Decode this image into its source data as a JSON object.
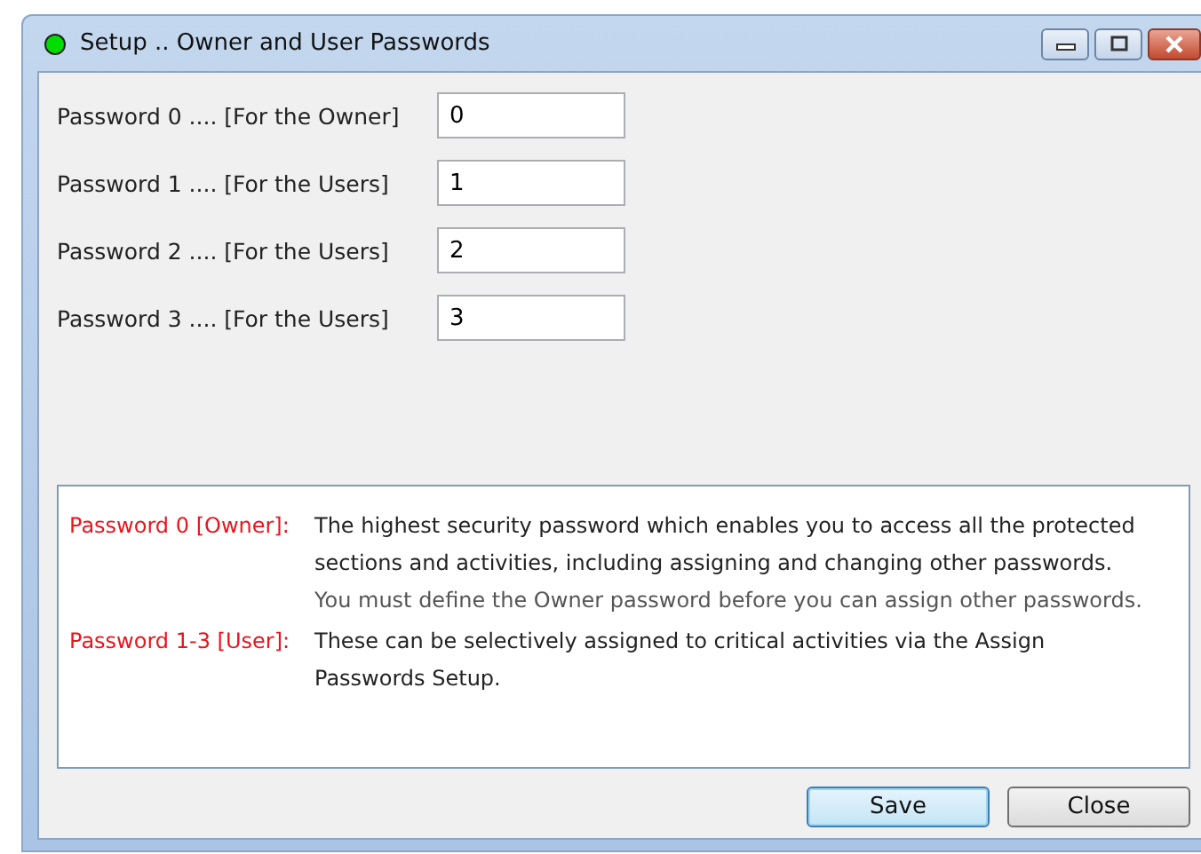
{
  "window": {
    "title": "Setup .. Owner and User Passwords"
  },
  "fields": [
    {
      "label": "Password 0 .... [For the Owner]",
      "value": "0"
    },
    {
      "label": "Password 1 .... [For the Users]",
      "value": "1"
    },
    {
      "label": "Password 2 .... [For the Users]",
      "value": "2"
    },
    {
      "label": "Password 3 .... [For the Users]",
      "value": "3"
    }
  ],
  "notes": [
    {
      "term": "Password 0 [Owner]:",
      "paragraphs": [
        {
          "kind": "main",
          "text": "The highest security password which enables you to access all the protected sections and activities, including assigning and changing other passwords."
        },
        {
          "kind": "hint",
          "text": "You must define the Owner password before you can assign other passwords."
        }
      ]
    },
    {
      "term": "Password 1-3 [User]:",
      "paragraphs": [
        {
          "kind": "main",
          "text": "These can be selectively assigned to critical activities via the Assign Passwords Setup."
        }
      ]
    }
  ],
  "buttons": [
    {
      "label": "Save",
      "default": true
    },
    {
      "label": "Close",
      "default": false
    }
  ]
}
